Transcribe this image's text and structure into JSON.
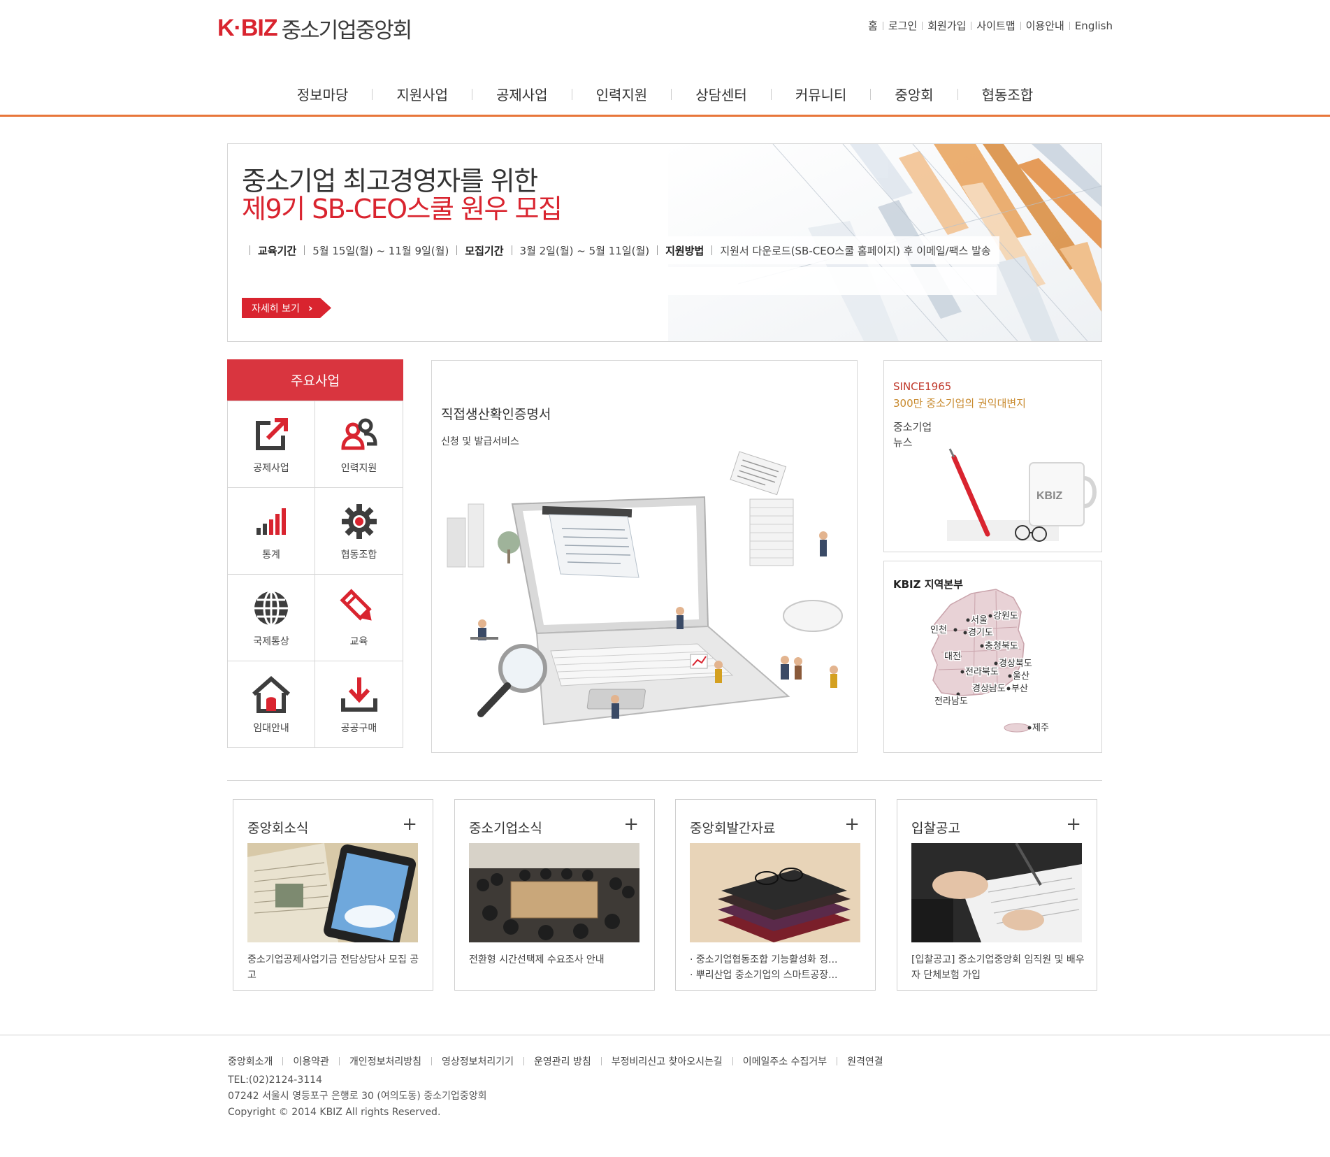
{
  "header": {
    "logo_brand": "K·BIZ",
    "logo_name": "중소기업중앙회",
    "util_links": [
      "홈",
      "로그인",
      "회원가입",
      "사이트맵",
      "이용안내",
      "English"
    ]
  },
  "gnb": [
    "정보마당",
    "지원사업",
    "공제사업",
    "인력지원",
    "상담센터",
    "커뮤니티",
    "중앙회",
    "협동조합"
  ],
  "banner": {
    "title1": "중소기업 최고경영자를 위한",
    "title2": "제9기 SB-CEO스쿨 원우 모집",
    "edu_label": "교육기간",
    "edu_value": "5월 15일(월) ~ 11월 9일(월)",
    "recruit_label": "모집기간",
    "recruit_value": "3월 2일(월) ~ 5월 11일(월)",
    "method_label": "지원방법",
    "method_value": "지원서 다운로드(SB-CEO스쿨 홈페이지) 후 이메일/팩스 발송",
    "button": "자세히 보기"
  },
  "biz": {
    "title": "주요사업",
    "items": [
      {
        "label": "공제사업",
        "icon": "external-link-icon"
      },
      {
        "label": "인력지원",
        "icon": "people-icon"
      },
      {
        "label": "통계",
        "icon": "signal-bars-icon"
      },
      {
        "label": "협동조합",
        "icon": "gear-icon"
      },
      {
        "label": "국제통상",
        "icon": "globe-icon"
      },
      {
        "label": "교육",
        "icon": "pencil-icon"
      },
      {
        "label": "임대안내",
        "icon": "house-icon"
      },
      {
        "label": "공공구매",
        "icon": "download-icon"
      }
    ]
  },
  "feature": {
    "title": "직접생산확인증명서",
    "subtitle": "신청 및 발급서비스"
  },
  "news_box": {
    "since": "SINCE1965",
    "tagline": "300만 중소기업의 권익대변지",
    "line1": "중소기업",
    "line2": "뉴스",
    "mug_text": "KBIZ"
  },
  "region": {
    "title": "KBIZ 지역본부",
    "labels": [
      "서울",
      "강원도",
      "인천",
      "경기도",
      "충청북도",
      "대전",
      "경상북도",
      "전라북도",
      "울산",
      "경상남도",
      "부산",
      "전라남도",
      "제주"
    ]
  },
  "cards": [
    {
      "title": "중앙회소식",
      "plus": "+",
      "texts": [
        "중소기업공제사업기금 전담상담사 모집 공고"
      ],
      "bullets": false
    },
    {
      "title": "중소기업소식",
      "plus": "+",
      "texts": [
        "전환형 시간선택제 수요조사 안내"
      ],
      "bullets": false
    },
    {
      "title": "중앙회발간자료",
      "plus": "+",
      "texts": [
        "중소기업협동조합 기능활성화 정...",
        "뿌리산업 중소기업의 스마트공장..."
      ],
      "bullets": true
    },
    {
      "title": "입찰공고",
      "plus": "+",
      "texts": [
        "[입찰공고] 중소기업중앙회 임직원 및 배우자 단체보험 가입"
      ],
      "bullets": false
    }
  ],
  "footer": {
    "links": [
      "중앙회소개",
      "이용약관",
      "개인정보처리방침",
      "영상정보처리기기",
      "운영관리 방침",
      "부정비리신고 찾아오시는길",
      "이메일주소 수집거부",
      "원격연결"
    ],
    "tel": "TEL:(02)2124-3114",
    "address": "07242 서울시 영등포구 은행로 30 (여의도동) 중소기업중앙회",
    "copyright": "Copyright © 2014 KBIZ All rights Reserved."
  },
  "colors": {
    "brand_red": "#d9242f",
    "nav_line": "#e8763a",
    "biz_header": "#d9353f"
  }
}
